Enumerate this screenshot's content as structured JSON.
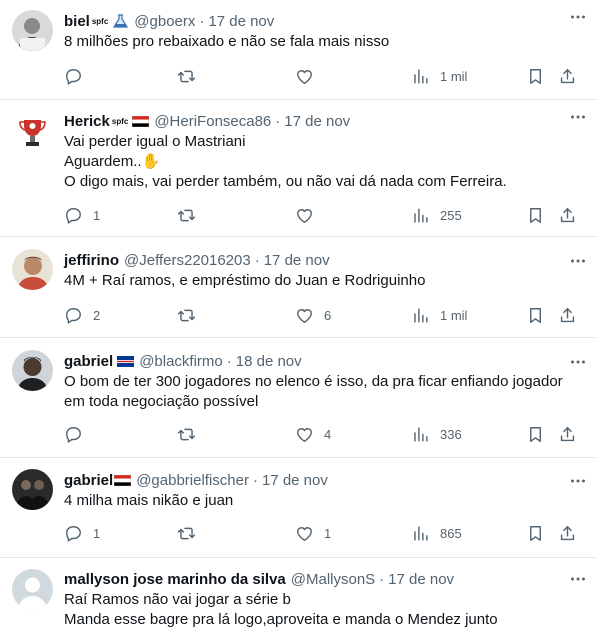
{
  "tweets": [
    {
      "name": "biel",
      "badge": "spfc",
      "handle": "@gboerx",
      "sep": "·",
      "date": "17 de nov",
      "lines": [
        "8 milhões pro rebaixado e não se fala mais nisso"
      ],
      "replies": "",
      "likes": "",
      "views": "1 mil"
    },
    {
      "name": "Herick",
      "badge": "spfc",
      "handle": "@HeriFonseca86",
      "sep": "·",
      "date": "17 de nov",
      "lines": [
        "Vai perder igual o Mastriani",
        "Aguardem..✋",
        "O digo mais, vai perder também, ou não vai dá nada com Ferreira."
      ],
      "replies": "1",
      "likes": "",
      "views": "255"
    },
    {
      "name": "jeffirino",
      "badge": "",
      "handle": "@Jeffers22016203",
      "sep": "·",
      "date": "17 de nov",
      "lines": [
        "4M + Raí ramos, e empréstimo do Juan e Rodriguinho"
      ],
      "replies": "2",
      "likes": "6",
      "views": "1 mil"
    },
    {
      "name": "gabriel",
      "badge": "",
      "handle": "@blackfirmo",
      "sep": "·",
      "date": "18 de nov",
      "lines": [
        "O bom de ter 300 jogadores no elenco é isso, da pra ficar enfiando jogador",
        "em toda negociação possível"
      ],
      "replies": "",
      "likes": "4",
      "views": "336"
    },
    {
      "name": "gabriel",
      "badge": "",
      "handle": "@gabbrielfischer",
      "sep": "·",
      "date": "17 de nov",
      "lines": [
        "4 milha mais nikão e juan"
      ],
      "replies": "1",
      "likes": "1",
      "views": "865"
    },
    {
      "name": "mallyson jose marinho da silva",
      "badge": "",
      "handle": "@MallysonS",
      "sep": "·",
      "date": "17 de nov",
      "lines": [
        "Raí Ramos não vai jogar a série b",
        "Manda esse bagre pra lá logo,aproveita e manda o Mendez junto"
      ],
      "replies": "",
      "likes": "",
      "views": ""
    }
  ]
}
